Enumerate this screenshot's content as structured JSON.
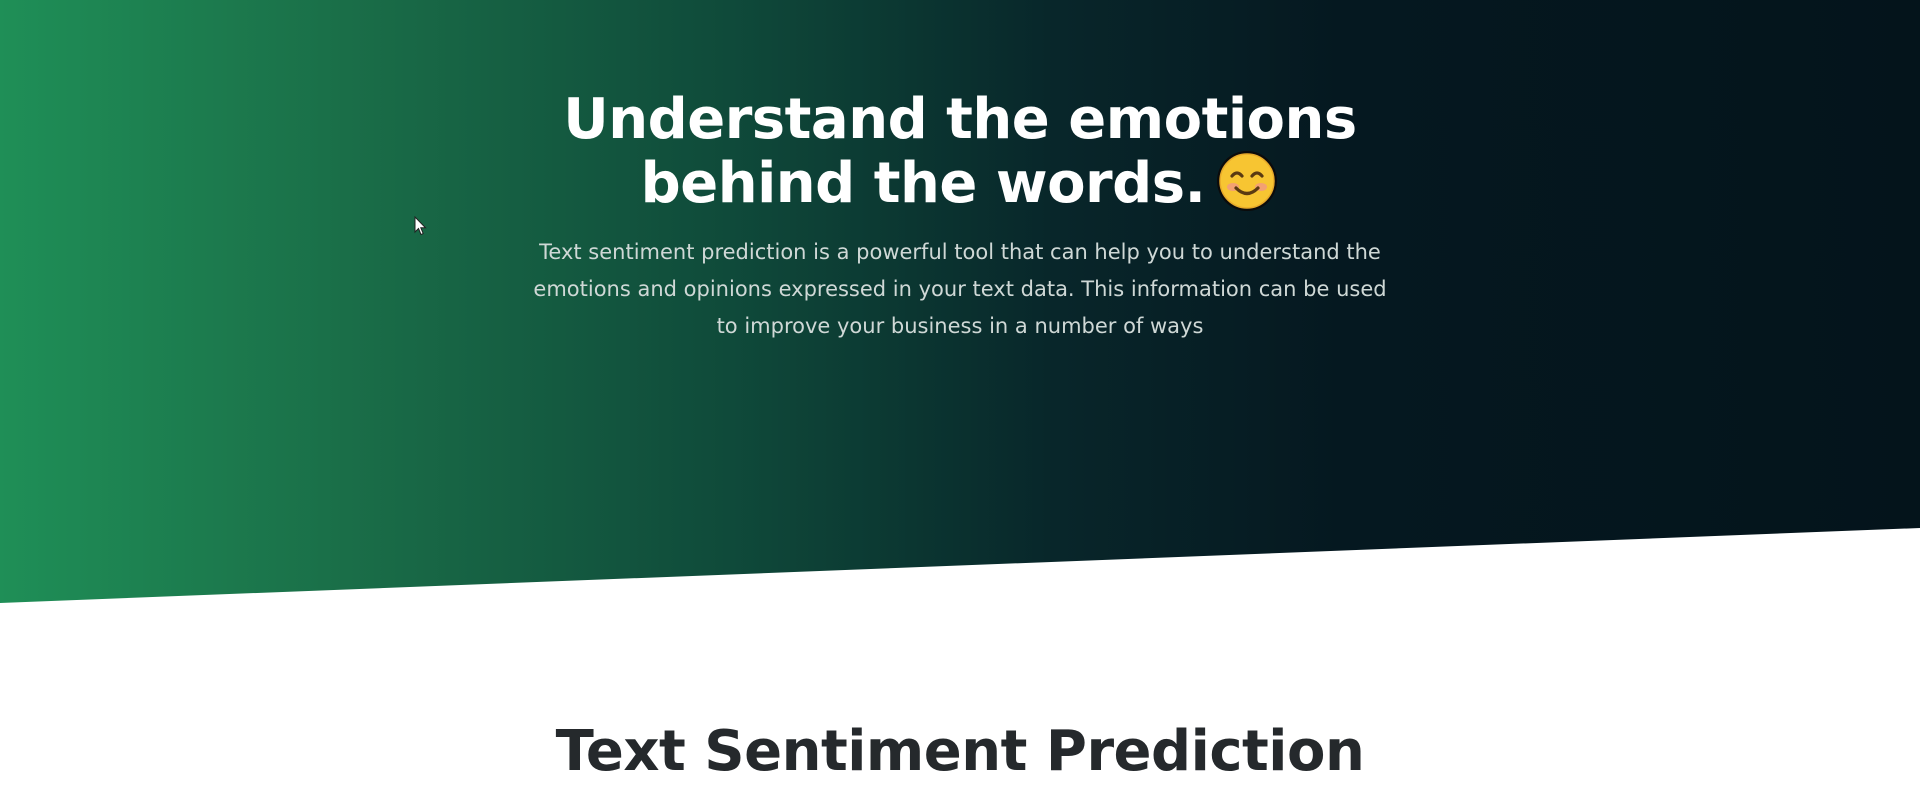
{
  "hero": {
    "title_line1": "Understand the emotions",
    "title_line2": "behind the words.",
    "emoji_icon": "smiling-face-emoji",
    "description": "Text sentiment prediction is a powerful tool that can help you to understand the emotions and opinions expressed in your text data. This information can be used to improve your business in a number of ways"
  },
  "section": {
    "title": "Text Sentiment Prediction"
  },
  "colors": {
    "gradient_start": "#1f8f57",
    "gradient_end": "#04141b",
    "title_text": "#ffffff",
    "body_text": "#cfd8d6",
    "section_title": "#25292c"
  }
}
